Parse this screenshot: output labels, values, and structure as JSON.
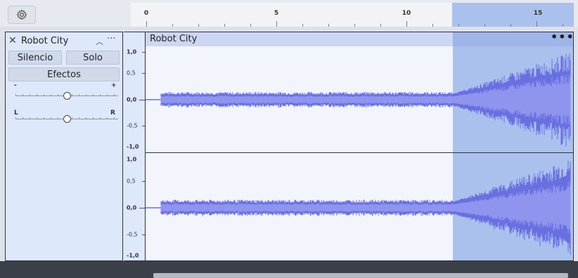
{
  "ruler": {
    "ticks": [
      "0",
      "5",
      "10",
      "15"
    ]
  },
  "track": {
    "name": "Robot City",
    "mute_label": "Silencio",
    "solo_label": "Solo",
    "effects_label": "Efectos",
    "gain_minus": "-",
    "gain_plus": "+",
    "pan_left": "L",
    "pan_right": "R",
    "gain_level": 0.5,
    "pan_level": 0.5
  },
  "clip": {
    "title": "Robot City",
    "menu": "•••"
  },
  "vertical_scale": [
    "1,0",
    "0,5",
    "0,0",
    "-0,5",
    "-1,0"
  ],
  "colors": {
    "waveform": "#6a6fe0",
    "waveform_rms": "#8f95ee",
    "selection": "#aac1ee",
    "clip_bg": "#f3f5fd",
    "panel_bg": "#dde8fb"
  }
}
